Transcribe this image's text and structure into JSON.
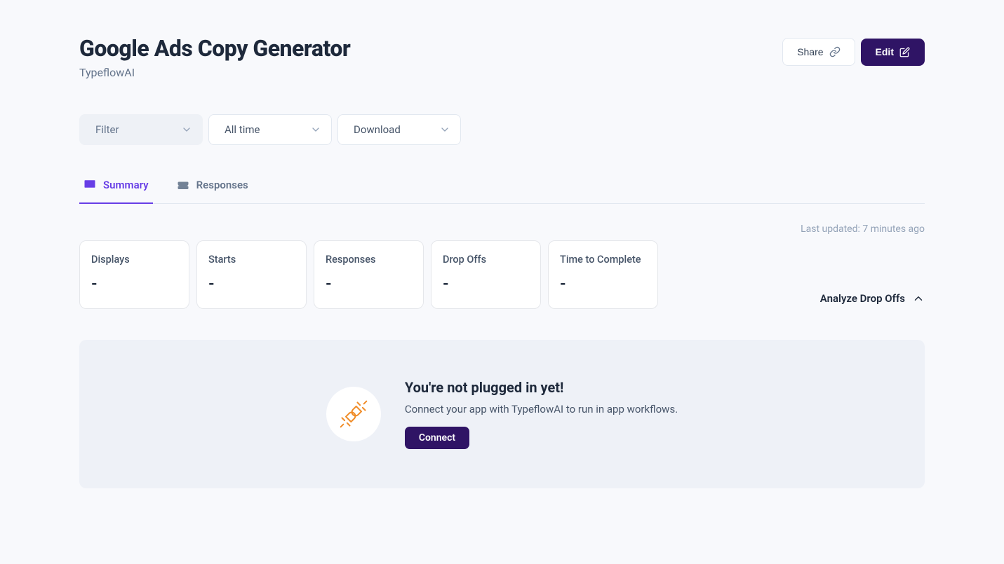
{
  "header": {
    "title": "Google Ads Copy Generator",
    "subtitle": "TypeflowAI",
    "share_label": "Share",
    "edit_label": "Edit"
  },
  "filters": {
    "filter_label": "Filter",
    "time_label": "All time",
    "download_label": "Download"
  },
  "tabs": {
    "summary_label": "Summary",
    "responses_label": "Responses"
  },
  "meta": {
    "last_updated": "Last updated: 7 minutes ago",
    "analyze_label": "Analyze Drop Offs"
  },
  "stats": [
    {
      "label": "Displays",
      "value": "-"
    },
    {
      "label": "Starts",
      "value": "-"
    },
    {
      "label": "Responses",
      "value": "-"
    },
    {
      "label": "Drop Offs",
      "value": "-"
    },
    {
      "label": "Time to Complete",
      "value": "-"
    }
  ],
  "connect": {
    "title": "You're not plugged in yet!",
    "description": "Connect your app with TypeflowAI to run in app workflows.",
    "button_label": "Connect"
  }
}
